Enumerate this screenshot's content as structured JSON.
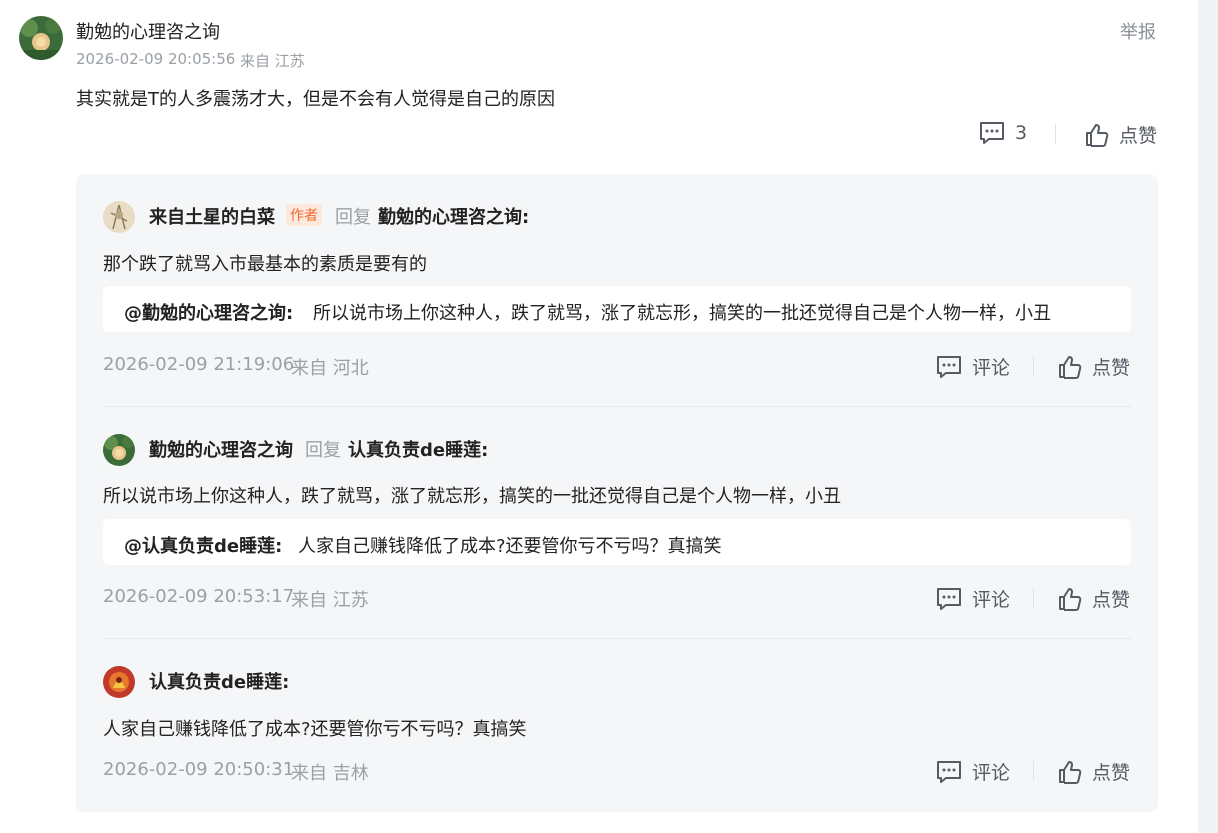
{
  "colors": {
    "accent_badge": "#f26a2e",
    "meta_gray": "#9aa0a6",
    "panel_bg": "#f5f6f8"
  },
  "main_comment": {
    "username": "勤勉的心理咨之询",
    "timestamp": "2026-02-09 20:05:56",
    "location": "来自 江苏",
    "report_label": "举报",
    "text": "其实就是T的人多震荡才大，但是不会有人觉得是自己的原因",
    "comment_count": "3",
    "like_label": "点赞",
    "comment_icon": "comment-icon",
    "like_icon": "thumbs-up-icon"
  },
  "replies": [
    {
      "username": "来自土星的白菜",
      "badge": "作者",
      "reply_word": "回复",
      "reply_to": "勤勉的心理咨之询:",
      "text": "那个跌了就骂入市最基本的素质是要有的",
      "quote_at": "@勤勉的心理咨之询:",
      "quote_text": "所以说市场上你这种人，跌了就骂，涨了就忘形，搞笑的一批还觉得自己是个人物一样，小丑",
      "timestamp": "2026-02-09 21:19:06",
      "location": "来自 河北",
      "comment_label": "评论",
      "like_label": "点赞"
    },
    {
      "username": "勤勉的心理咨之询",
      "reply_word": "回复",
      "reply_to": "认真负责de睡莲:",
      "text": "所以说市场上你这种人，跌了就骂，涨了就忘形，搞笑的一批还觉得自己是个人物一样，小丑",
      "quote_at": "@认真负责de睡莲:",
      "quote_text": "人家自己赚钱降低了成本?还要管你亏不亏吗？真搞笑",
      "timestamp": "2026-02-09 20:53:17",
      "location": "来自 江苏",
      "comment_label": "评论",
      "like_label": "点赞"
    },
    {
      "username": "认真负责de睡莲:",
      "text": "人家自己赚钱降低了成本?还要管你亏不亏吗？真搞笑",
      "timestamp": "2026-02-09 20:50:31",
      "location": "来自 吉林",
      "comment_label": "评论",
      "like_label": "点赞"
    }
  ]
}
